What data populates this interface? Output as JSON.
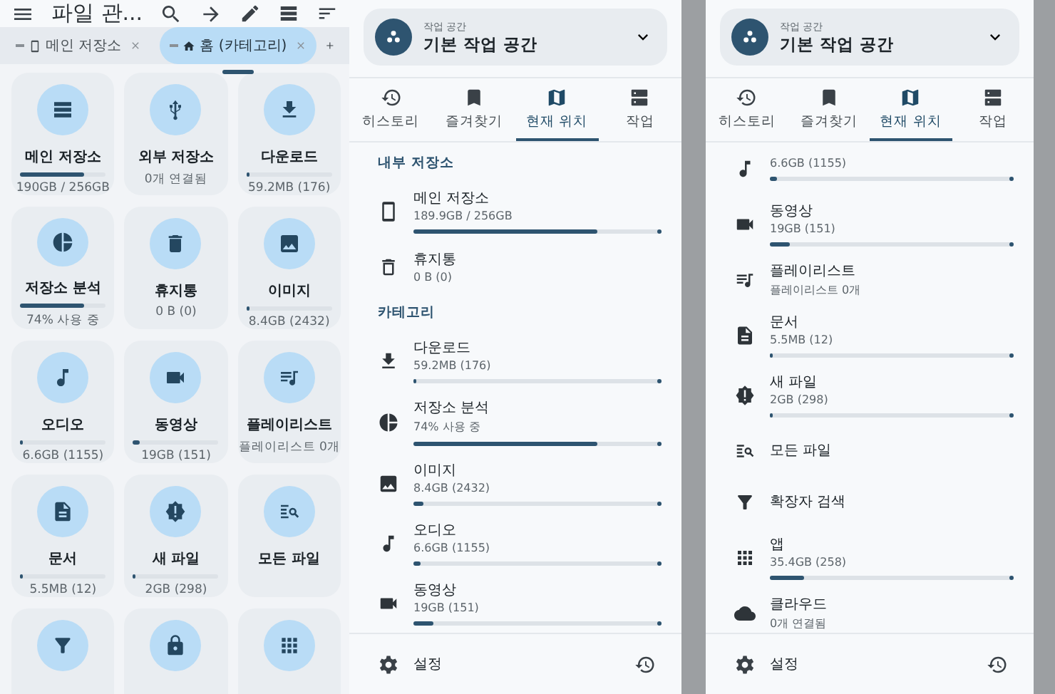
{
  "main": {
    "title": "파일 관...",
    "tabs": [
      {
        "label": "메인 저장소",
        "selected": false
      },
      {
        "label": "홈 (카테고리)",
        "selected": true
      }
    ],
    "cards": [
      {
        "kind": "full",
        "name": "메인 저장소",
        "sub": "190GB / 256GB",
        "level": 0.74
      },
      {
        "kind": "full",
        "name": "외부 저장소",
        "sub": "0개 연결됨"
      },
      {
        "kind": "full",
        "name": "다운로드",
        "sub": "59.2MB (176)",
        "level": 0.01
      },
      {
        "kind": "full",
        "name": "저장소 분석",
        "sub": "74% 사용 중",
        "level": 0.74
      },
      {
        "kind": "full",
        "name": "휴지통",
        "sub": "0 B (0)"
      },
      {
        "kind": "full",
        "name": "이미지",
        "sub": "8.4GB (2432)",
        "level": 0.02
      },
      {
        "kind": "full",
        "name": "오디오",
        "sub": "6.6GB (1155)",
        "level": 0.02
      },
      {
        "kind": "full",
        "name": "동영상",
        "sub": "19GB (151)",
        "level": 0.07
      },
      {
        "kind": "full",
        "name": "플레이리스트",
        "sub": "플레이리스트 0개"
      },
      {
        "kind": "full",
        "name": "문서",
        "sub": "5.5MB (12)",
        "level": 0.01
      },
      {
        "kind": "full",
        "name": "새 파일",
        "sub": "2GB (298)",
        "level": 0.01
      },
      {
        "kind": "full",
        "name": "모든 파일"
      },
      {
        "kind": "cut"
      },
      {
        "kind": "cut"
      },
      {
        "kind": "cut"
      }
    ]
  },
  "drawers": [
    {
      "workspace": {
        "caption": "작업 공간",
        "name": "기본 작업 공간"
      },
      "tabs": [
        {
          "label": "히스토리",
          "selected": false
        },
        {
          "label": "즐겨찾기",
          "selected": false
        },
        {
          "label": "현재 위치",
          "selected": true
        },
        {
          "label": "작업",
          "selected": false
        }
      ],
      "list": [
        {
          "kind": "header",
          "label": "내부 저장소"
        },
        {
          "kind": "entry",
          "name": "메인 저장소",
          "sub": "189.9GB / 256GB",
          "level": 0.74
        },
        {
          "kind": "entry",
          "name": "휴지통",
          "sub": "0 B (0)"
        },
        {
          "kind": "header",
          "label": "카테고리"
        },
        {
          "kind": "entry",
          "name": "다운로드",
          "sub": "59.2MB (176)",
          "level": 0.01
        },
        {
          "kind": "entry",
          "name": "저장소 분석",
          "sub": "74% 사용 중",
          "level": 0.74
        },
        {
          "kind": "entry",
          "name": "이미지",
          "sub": "8.4GB (2432)",
          "level": 0.04
        },
        {
          "kind": "entry",
          "name": "오디오",
          "sub": "6.6GB (1155)",
          "level": 0.03
        },
        {
          "kind": "entry",
          "name": "동영상",
          "sub": "19GB (151)",
          "level": 0.08
        }
      ],
      "footer": {
        "label": "설정"
      }
    },
    {
      "workspace": {
        "caption": "작업 공간",
        "name": "기본 작업 공간"
      },
      "tabs": [
        {
          "label": "히스토리",
          "selected": false
        },
        {
          "label": "즐겨찾기",
          "selected": false
        },
        {
          "label": "현재 위치",
          "selected": true
        },
        {
          "label": "작업",
          "selected": false
        }
      ],
      "list": [
        {
          "kind": "entry",
          "sub": "6.6GB (1155)",
          "level": 0.03
        },
        {
          "kind": "entry",
          "name": "동영상",
          "sub": "19GB (151)",
          "level": 0.08
        },
        {
          "kind": "entry",
          "name": "플레이리스트",
          "sub": "플레이리스트 0개"
        },
        {
          "kind": "entry",
          "name": "문서",
          "sub": "5.5MB (12)",
          "level": 0.01
        },
        {
          "kind": "entry",
          "name": "새 파일",
          "sub": "2GB (298)",
          "level": 0.01
        },
        {
          "kind": "entry",
          "name": "모든 파일"
        },
        {
          "kind": "entry",
          "name": "확장자 검색"
        },
        {
          "kind": "entry",
          "name": "앱",
          "sub": "35.4GB (258)",
          "level": 0.14
        },
        {
          "kind": "entry",
          "name": "클라우드",
          "sub": "0개 연결됨"
        }
      ],
      "footer": {
        "label": "설정"
      }
    }
  ]
}
